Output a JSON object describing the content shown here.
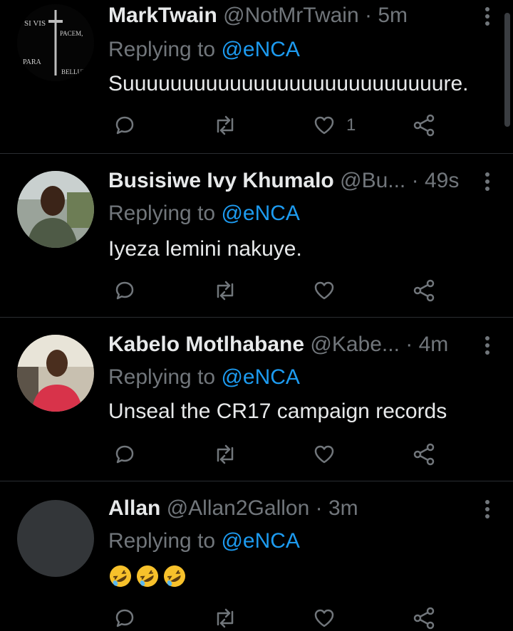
{
  "colors": {
    "background": "#000000",
    "text": "#e7e9ea",
    "muted": "#71767b",
    "accent": "#1d9bf0",
    "divider": "#2a2d31"
  },
  "tweets": [
    {
      "name": "MarkTwain",
      "handle": "@NotMrTwain",
      "separator": "·",
      "time": "5m",
      "reply_prefix": "Replying to",
      "reply_to": "@eNCA",
      "text": "Suuuuuuuuuuuuuuuuuuuuuuuuuuure.",
      "likes": "1",
      "avatar_text": {
        "l1": "SI VIS",
        "l2": "PACEM,",
        "l3": "PARA",
        "l4": "BELLUM"
      },
      "avatar": "si-vis-pacem-logo"
    },
    {
      "name": "Busisiwe Ivy Khumalo",
      "handle": "@Bu...",
      "separator": "·",
      "time": "49s",
      "reply_prefix": "Replying to",
      "reply_to": "@eNCA",
      "text": "Iyeza lemini nakuye.",
      "likes": "",
      "avatar": "person-photo"
    },
    {
      "name": "Kabelo Motlhabane",
      "handle": "@Kabe...",
      "separator": "·",
      "time": "4m",
      "reply_prefix": "Replying to",
      "reply_to": "@eNCA",
      "text": "Unseal the CR17 campaign records",
      "likes": "",
      "avatar": "person-photo"
    },
    {
      "name": "Allan",
      "handle": "@Allan2Gallon",
      "separator": "·",
      "time": "3m",
      "reply_prefix": "Replying to",
      "reply_to": "@eNCA",
      "text": "",
      "emojis": [
        "rolling-on-floor-laughing",
        "rolling-on-floor-laughing",
        "rolling-on-floor-laughing"
      ],
      "likes": "",
      "avatar": "blank"
    }
  ],
  "icons": {
    "reply": "comment-icon",
    "retweet": "retweet-icon",
    "like": "heart-icon",
    "share": "share-icon",
    "more": "more-vertical-icon"
  }
}
